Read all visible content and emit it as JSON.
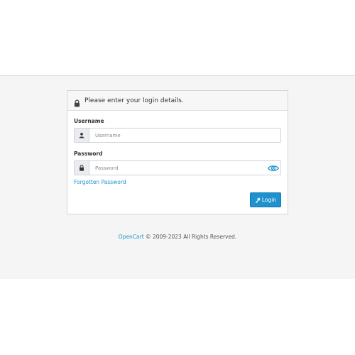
{
  "login_card": {
    "header_text": "Please enter your login details.",
    "username": {
      "label": "Username",
      "placeholder": "Username",
      "value": ""
    },
    "password": {
      "label": "Password",
      "placeholder": "Password",
      "value": ""
    },
    "forgot_link": "Forgotten Password",
    "login_button": "Login"
  },
  "footer": {
    "brand_link": "OpenCart",
    "copyright": " © 2009-2023 All Rights Reserved."
  },
  "colors": {
    "accent": "#1e91cf",
    "background": "#f5f5f5"
  },
  "icons": {
    "header": "lock-icon",
    "username_addon": "user-icon",
    "password_addon": "lock-icon",
    "password_toggle": "eye-icon",
    "login_button": "key-icon"
  }
}
